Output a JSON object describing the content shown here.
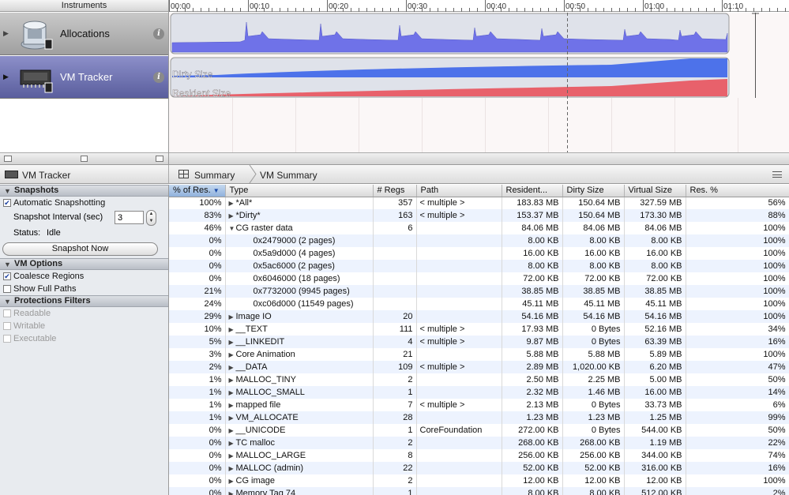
{
  "instruments_header": "Instruments",
  "instruments": [
    {
      "name": "Allocations"
    },
    {
      "name": "VM Tracker"
    }
  ],
  "timeline": {
    "ticks": [
      "00:00",
      "00:10",
      "00:20",
      "00:30",
      "00:40",
      "00:50",
      "01:00",
      "01:10"
    ],
    "vm_labels": {
      "dirty": "Dirty Size",
      "resident": "Resident Size"
    }
  },
  "breadcrumb": {
    "instrument": "VM Tracker",
    "items": [
      "Summary",
      "VM Summary"
    ]
  },
  "left_panel": {
    "snapshots": {
      "title": "Snapshots",
      "auto_label": "Automatic Snapshotting",
      "auto_checked": true,
      "interval_label": "Snapshot Interval (sec)",
      "interval_value": "3",
      "status_label": "Status:",
      "status_value": "Idle",
      "button": "Snapshot Now"
    },
    "vm_options": {
      "title": "VM Options",
      "coalesce_label": "Coalesce Regions",
      "coalesce_checked": true,
      "full_paths_label": "Show Full Paths",
      "full_paths_checked": false
    },
    "protections": {
      "title": "Protections Filters",
      "items": [
        "Readable",
        "Writable",
        "Executable"
      ]
    }
  },
  "table": {
    "columns": [
      "% of Res.",
      "Type",
      "# Regs",
      "Path",
      "Resident...",
      "Dirty Size",
      "Virtual Size",
      "Res. %"
    ],
    "rows": [
      {
        "pct": "100%",
        "toggle": "closed",
        "indent": 0,
        "type": "*All*",
        "regs": "357",
        "path": "< multiple >",
        "resident": "183.83 MB",
        "dirty": "150.64 MB",
        "virtual": "327.59 MB",
        "resp": "56%"
      },
      {
        "pct": "83%",
        "toggle": "closed",
        "indent": 0,
        "type": "*Dirty*",
        "regs": "163",
        "path": "< multiple >",
        "resident": "153.37 MB",
        "dirty": "150.64 MB",
        "virtual": "173.30 MB",
        "resp": "88%"
      },
      {
        "pct": "46%",
        "toggle": "open",
        "indent": 0,
        "type": "CG raster data",
        "regs": "6",
        "path": "",
        "resident": "84.06 MB",
        "dirty": "84.06 MB",
        "virtual": "84.06 MB",
        "resp": "100%"
      },
      {
        "pct": "0%",
        "toggle": "none",
        "indent": 1,
        "type": "0x2479000 (2 pages)",
        "regs": "",
        "path": "",
        "resident": "8.00 KB",
        "dirty": "8.00 KB",
        "virtual": "8.00 KB",
        "resp": "100%"
      },
      {
        "pct": "0%",
        "toggle": "none",
        "indent": 1,
        "type": "0x5a9d000 (4 pages)",
        "regs": "",
        "path": "",
        "resident": "16.00 KB",
        "dirty": "16.00 KB",
        "virtual": "16.00 KB",
        "resp": "100%"
      },
      {
        "pct": "0%",
        "toggle": "none",
        "indent": 1,
        "type": "0x5ac6000 (2 pages)",
        "regs": "",
        "path": "",
        "resident": "8.00 KB",
        "dirty": "8.00 KB",
        "virtual": "8.00 KB",
        "resp": "100%"
      },
      {
        "pct": "0%",
        "toggle": "none",
        "indent": 1,
        "type": "0x6046000 (18 pages)",
        "regs": "",
        "path": "",
        "resident": "72.00 KB",
        "dirty": "72.00 KB",
        "virtual": "72.00 KB",
        "resp": "100%"
      },
      {
        "pct": "21%",
        "toggle": "none",
        "indent": 1,
        "type": "0x7732000 (9945 pages)",
        "regs": "",
        "path": "",
        "resident": "38.85 MB",
        "dirty": "38.85 MB",
        "virtual": "38.85 MB",
        "resp": "100%"
      },
      {
        "pct": "24%",
        "toggle": "none",
        "indent": 1,
        "type": "0xc06d000 (11549 pages)",
        "regs": "",
        "path": "",
        "resident": "45.11 MB",
        "dirty": "45.11 MB",
        "virtual": "45.11 MB",
        "resp": "100%"
      },
      {
        "pct": "29%",
        "toggle": "closed",
        "indent": 0,
        "type": "Image IO",
        "regs": "20",
        "path": "",
        "resident": "54.16 MB",
        "dirty": "54.16 MB",
        "virtual": "54.16 MB",
        "resp": "100%"
      },
      {
        "pct": "10%",
        "toggle": "closed",
        "indent": 0,
        "type": "__TEXT",
        "regs": "111",
        "path": "< multiple >",
        "resident": "17.93 MB",
        "dirty": "0 Bytes",
        "virtual": "52.16 MB",
        "resp": "34%"
      },
      {
        "pct": "5%",
        "toggle": "closed",
        "indent": 0,
        "type": "__LINKEDIT",
        "regs": "4",
        "path": "< multiple >",
        "resident": "9.87 MB",
        "dirty": "0 Bytes",
        "virtual": "63.39 MB",
        "resp": "16%"
      },
      {
        "pct": "3%",
        "toggle": "closed",
        "indent": 0,
        "type": "Core Animation",
        "regs": "21",
        "path": "",
        "resident": "5.88 MB",
        "dirty": "5.88 MB",
        "virtual": "5.89 MB",
        "resp": "100%"
      },
      {
        "pct": "2%",
        "toggle": "closed",
        "indent": 0,
        "type": "__DATA",
        "regs": "109",
        "path": "< multiple >",
        "resident": "2.89 MB",
        "dirty": "1,020.00 KB",
        "virtual": "6.20 MB",
        "resp": "47%"
      },
      {
        "pct": "1%",
        "toggle": "closed",
        "indent": 0,
        "type": "MALLOC_TINY",
        "regs": "2",
        "path": "",
        "resident": "2.50 MB",
        "dirty": "2.25 MB",
        "virtual": "5.00 MB",
        "resp": "50%"
      },
      {
        "pct": "1%",
        "toggle": "closed",
        "indent": 0,
        "type": "MALLOC_SMALL",
        "regs": "1",
        "path": "",
        "resident": "2.32 MB",
        "dirty": "1.46 MB",
        "virtual": "16.00 MB",
        "resp": "14%"
      },
      {
        "pct": "1%",
        "toggle": "closed",
        "indent": 0,
        "type": "mapped file",
        "regs": "7",
        "path": "< multiple >",
        "resident": "2.13 MB",
        "dirty": "0 Bytes",
        "virtual": "33.73 MB",
        "resp": "6%"
      },
      {
        "pct": "1%",
        "toggle": "closed",
        "indent": 0,
        "type": "VM_ALLOCATE",
        "regs": "28",
        "path": "",
        "resident": "1.23 MB",
        "dirty": "1.23 MB",
        "virtual": "1.25 MB",
        "resp": "99%"
      },
      {
        "pct": "0%",
        "toggle": "closed",
        "indent": 0,
        "type": "__UNICODE",
        "regs": "1",
        "path": "CoreFoundation",
        "resident": "272.00 KB",
        "dirty": "0 Bytes",
        "virtual": "544.00 KB",
        "resp": "50%"
      },
      {
        "pct": "0%",
        "toggle": "closed",
        "indent": 0,
        "type": "TC malloc",
        "regs": "2",
        "path": "",
        "resident": "268.00 KB",
        "dirty": "268.00 KB",
        "virtual": "1.19 MB",
        "resp": "22%"
      },
      {
        "pct": "0%",
        "toggle": "closed",
        "indent": 0,
        "type": "MALLOC_LARGE",
        "regs": "8",
        "path": "",
        "resident": "256.00 KB",
        "dirty": "256.00 KB",
        "virtual": "344.00 KB",
        "resp": "74%"
      },
      {
        "pct": "0%",
        "toggle": "closed",
        "indent": 0,
        "type": "MALLOC (admin)",
        "regs": "22",
        "path": "",
        "resident": "52.00 KB",
        "dirty": "52.00 KB",
        "virtual": "316.00 KB",
        "resp": "16%"
      },
      {
        "pct": "0%",
        "toggle": "closed",
        "indent": 0,
        "type": "CG image",
        "regs": "2",
        "path": "",
        "resident": "12.00 KB",
        "dirty": "12.00 KB",
        "virtual": "12.00 KB",
        "resp": "100%"
      },
      {
        "pct": "0%",
        "toggle": "closed",
        "indent": 0,
        "type": "Memory Tag 74",
        "regs": "1",
        "path": "",
        "resident": "8.00 KB",
        "dirty": "8.00 KB",
        "virtual": "512.00 KB",
        "resp": "2%"
      }
    ]
  },
  "colors": {
    "allocations_graph": "#6f72e8",
    "dirty_size": "#4d72ea",
    "resident_size": "#e8616b",
    "vm_row_selected": "#6a6eae",
    "row_alt": "#edf3fe"
  }
}
